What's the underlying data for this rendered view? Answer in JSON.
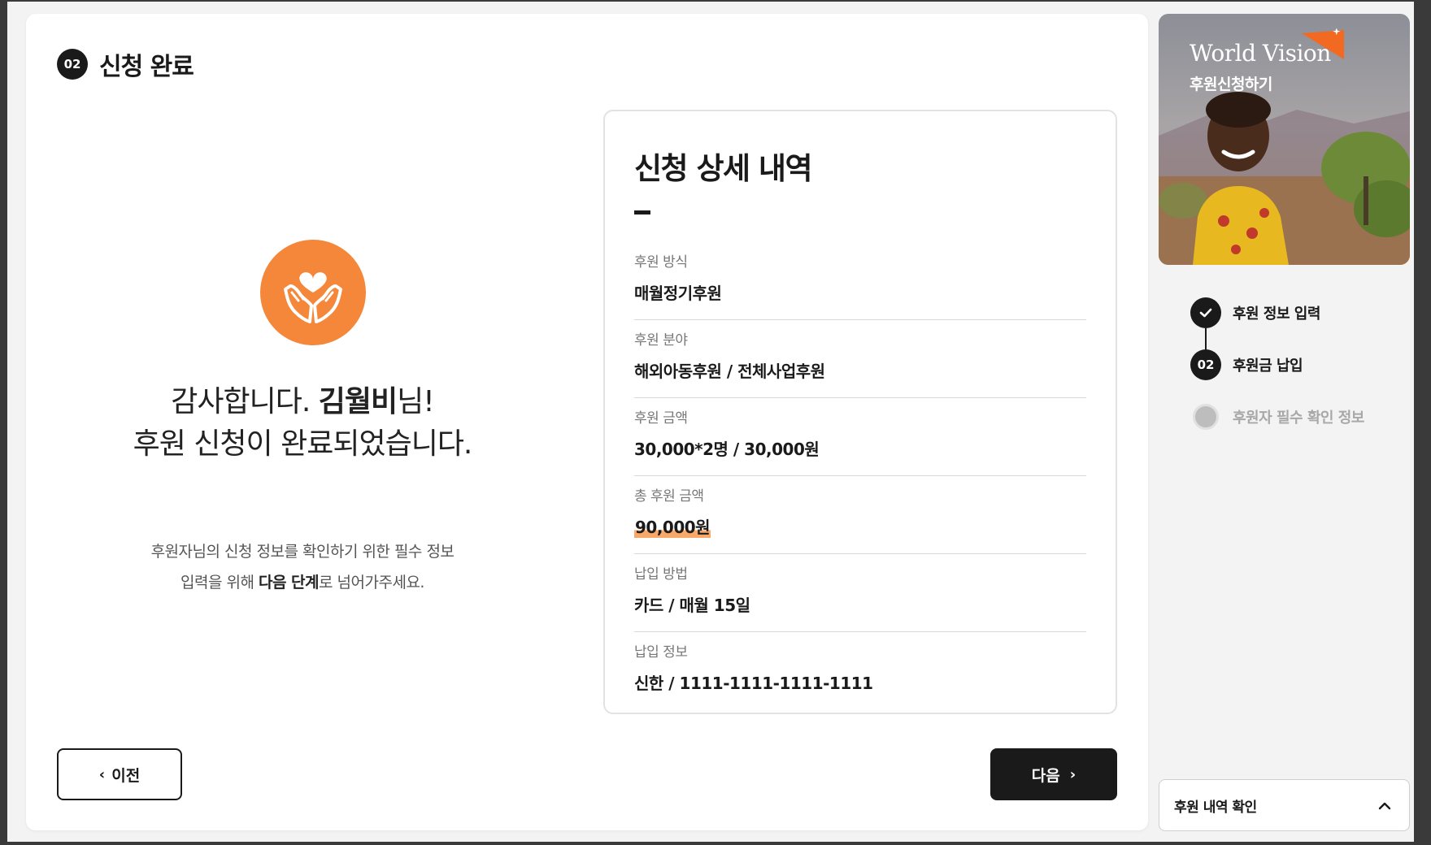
{
  "header": {
    "step_number": "02",
    "title": "신청 완료"
  },
  "thanks": {
    "line1_prefix": "감사합니다. ",
    "donor_name": "김월비",
    "line1_suffix": "님!",
    "line2": "후원 신청이 완료되었습니다."
  },
  "note": {
    "line1": "후원자님의 신청 정보를 확인하기 위한 필수 정보",
    "line2_prefix": "입력을 위해 ",
    "line2_bold": "다음 단계",
    "line2_suffix": "로 넘어가주세요."
  },
  "details": {
    "title": "신청 상세 내역",
    "rows": [
      {
        "label": "후원 방식",
        "value": "매월정기후원"
      },
      {
        "label": "후원 분야",
        "value": "해외아동후원 / 전체사업후원"
      },
      {
        "label": "후원 금액",
        "value": "30,000*2명 / 30,000원"
      },
      {
        "label": "총 후원 금액",
        "value": "90,000원"
      },
      {
        "label": "납입 방법",
        "value": "카드 / 매월 15일"
      },
      {
        "label": "납입 정보",
        "value": "신한 / 1111-1111-1111-1111"
      }
    ]
  },
  "buttons": {
    "prev_label": "이전",
    "next_label": "다음"
  },
  "sidebar": {
    "brand": "World Vision",
    "brand_subtitle": "후원신청하기",
    "steps": [
      {
        "number": "",
        "label": "후원 정보 입력",
        "status": "done"
      },
      {
        "number": "02",
        "label": "후원금 납입",
        "status": "current"
      },
      {
        "number": "",
        "label": "후원자 필수 확인 정보",
        "status": "pending"
      }
    ],
    "summary_label": "후원 내역 확인"
  },
  "colors": {
    "accent": "#f5873a",
    "highlight": "#f9a86a",
    "dark": "#1a1a1a",
    "muted": "#a8a8a8"
  },
  "icons": [
    "heart-hands-icon",
    "check-icon",
    "chevron-left-icon",
    "chevron-right-icon",
    "chevron-up-icon",
    "world-vision-logo"
  ]
}
